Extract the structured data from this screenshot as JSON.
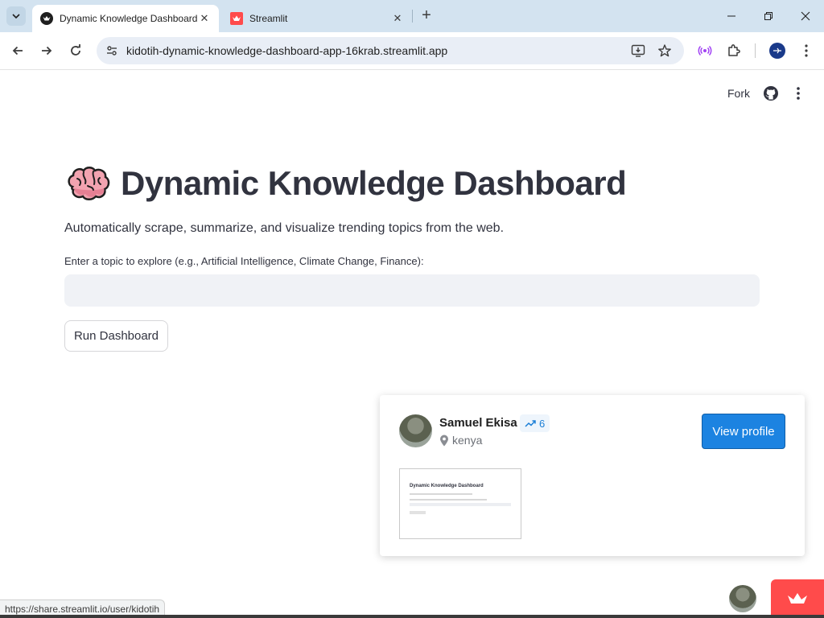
{
  "browser": {
    "tabs": [
      {
        "label": "Dynamic Knowledge Dashboard",
        "active": true
      },
      {
        "label": "Streamlit",
        "active": false
      }
    ],
    "url": "kidotih-dynamic-knowledge-dashboard-app-16krab.streamlit.app",
    "status_url": "https://share.streamlit.io/user/kidotih"
  },
  "streamlit_header": {
    "fork_label": "Fork"
  },
  "main": {
    "title": "Dynamic Knowledge Dashboard",
    "description": "Automatically scrape, summarize, and visualize trending topics from the web.",
    "input_label": "Enter a topic to explore (e.g., Artificial Intelligence, Climate Change, Finance):",
    "input_value": "",
    "run_button": "Run Dashboard"
  },
  "profile_card": {
    "name": "Samuel Ekisa",
    "trend_count": "6",
    "location": "kenya",
    "view_button": "View profile",
    "thumbnail_title": "Dynamic Knowledge Dashboard"
  },
  "colors": {
    "accent": "#1c83e1",
    "streamlit_red": "#ff4b4b",
    "text": "#31333f",
    "input_bg": "#f0f2f6"
  }
}
